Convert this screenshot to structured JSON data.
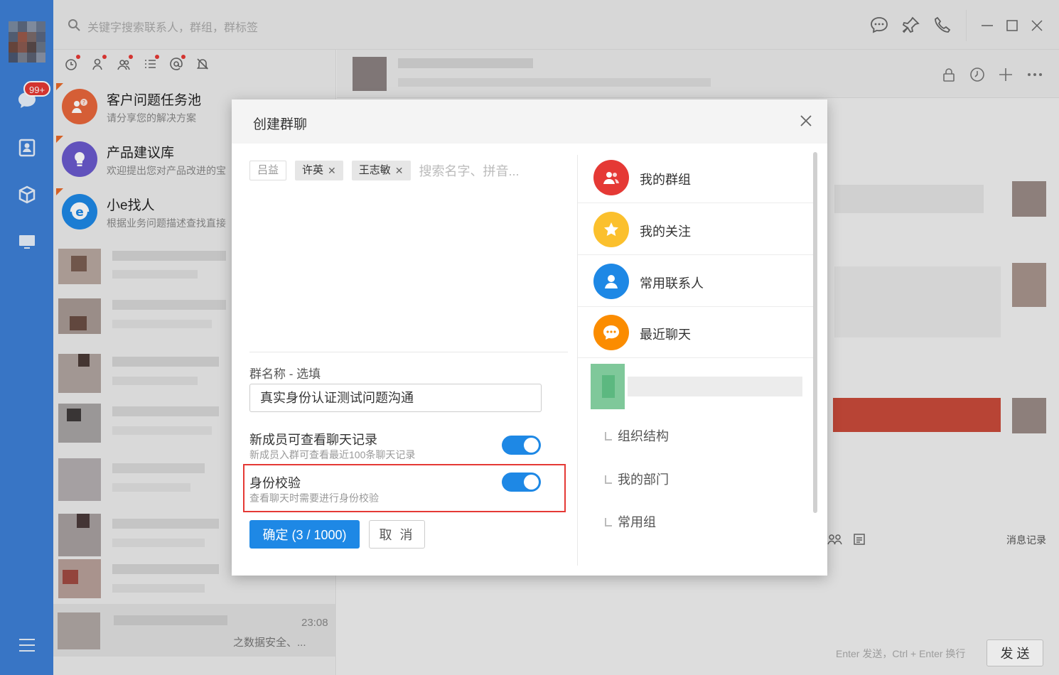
{
  "app": {
    "search_placeholder": "关键字搜索联系人，群组，群标签",
    "unread_badge": "99+",
    "chat_toolbar_history": "消息记录",
    "input_hint": "Enter 发送，Ctrl + Enter 换行",
    "send_label": "发 送",
    "session_time": "23:08",
    "session_snippet": "之数据安全、..."
  },
  "sessions": [
    {
      "title": "客户问题任务池",
      "snippet": "请分享您的解决方案",
      "icon": "customer-issues-icon",
      "color": "#e8673b"
    },
    {
      "title": "产品建议库",
      "snippet": "欢迎提出您对产品改进的宝",
      "icon": "lightbulb-icon",
      "color": "#6a5acd"
    },
    {
      "title": "小e找人",
      "snippet": "根据业务问题描述查找直接",
      "icon": "e-assistant-icon",
      "color": "#1e88e5"
    }
  ],
  "dialog": {
    "title": "创建群聊",
    "selected": [
      {
        "name": "吕益",
        "removable": false
      },
      {
        "name": "许英",
        "removable": true
      },
      {
        "name": "王志敏",
        "removable": true
      }
    ],
    "search_placeholder": "搜索名字、拼音...",
    "name_label": "群名称 - 选填",
    "name_value": "真实身份认证测试问题沟通",
    "history_label": "新成员可查看聊天记录",
    "history_desc": "新成员入群可查看最近100条聊天记录",
    "history_on": true,
    "verify_label": "身份校验",
    "verify_desc": "查看聊天时需要进行身份校验",
    "verify_on": true,
    "ok_label": "确定 (3 / 1000)",
    "cancel_label": "取 消",
    "categories": [
      {
        "label": "我的群组",
        "icon": "group-icon",
        "color": "#e53935"
      },
      {
        "label": "我的关注",
        "icon": "star-icon",
        "color": "#fbc02d"
      },
      {
        "label": "常用联系人",
        "icon": "contact-icon",
        "color": "#1e88e5"
      },
      {
        "label": "最近聊天",
        "icon": "chat-bubble-icon",
        "color": "#fb8c00"
      }
    ],
    "org_nodes": [
      "组织结构",
      "我的部门",
      "常用组"
    ]
  }
}
